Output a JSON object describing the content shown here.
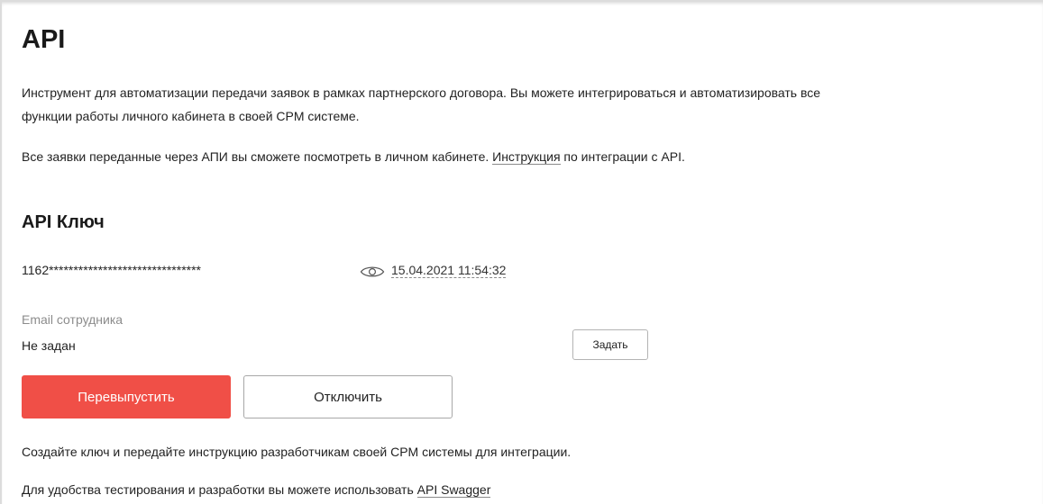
{
  "page": {
    "title": "API",
    "intro_line1": "Инструмент для автоматизации передачи заявок в рамках партнерского договора. Вы можете интегрироваться и автоматизировать все",
    "intro_line2": "функции работы личного кабинета в своей CPM системе.",
    "info_prefix": "Все заявки переданные через АПИ вы сможете посмотреть в личном кабинете. ",
    "info_link": "Инструкция",
    "info_suffix": " по интеграции с API."
  },
  "api_key": {
    "heading": "API Ключ",
    "masked_key": "1162*******************************",
    "eye_icon": "eye-icon",
    "date": "15.04.2021 11:54:32"
  },
  "employee_email": {
    "label": "Email сотрудника",
    "value": "Не задан",
    "set_button": "Задать"
  },
  "actions": {
    "reissue_button": "Перевыпустить",
    "disable_button": "Отключить"
  },
  "footer": {
    "create_hint": "Создайте ключ и передайте инструкцию разработчикам своей CPM системы для интеграции.",
    "swagger_prefix": "Для удобства тестирования и разработки вы можете использовать ",
    "swagger_link": "API Swagger"
  },
  "colors": {
    "primary": "#f04f47",
    "text": "#222222",
    "muted": "#8c8c8c",
    "border": "#b3b3b3"
  }
}
